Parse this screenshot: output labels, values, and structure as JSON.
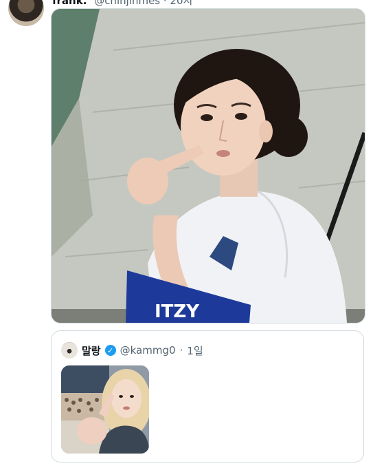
{
  "post": {
    "author_name": "frank.",
    "author_handle": "@chinjinmes · 20시"
  },
  "media": {
    "banner_text": "ITZY"
  },
  "quote": {
    "author_name": "말랑",
    "author_handle": "@kammg0",
    "separator": "·",
    "time": "1일"
  },
  "icons": {
    "verified": "verified-badge-icon"
  },
  "colors": {
    "verified_blue": "#1d9bf0",
    "border": "#cfd9de",
    "secondary_text": "#536471"
  }
}
